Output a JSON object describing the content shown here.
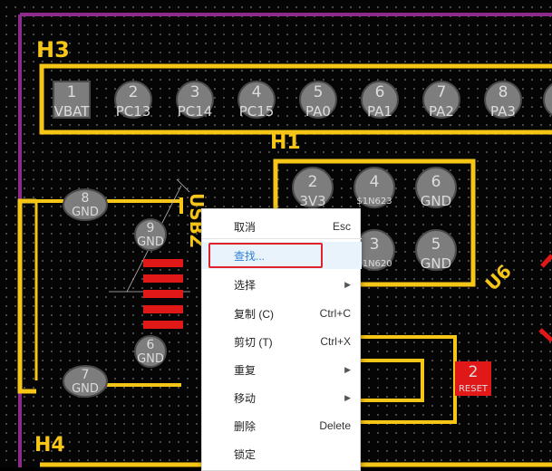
{
  "board": {
    "headers": {
      "h3": "H3",
      "h1": "H1",
      "h4": "H4",
      "usb": "USBZ",
      "u6": "U6"
    },
    "h3_pads": [
      {
        "num": "1",
        "name": "VBAT"
      },
      {
        "num": "2",
        "name": "PC13"
      },
      {
        "num": "3",
        "name": "PC14"
      },
      {
        "num": "4",
        "name": "PC15"
      },
      {
        "num": "5",
        "name": "PA0"
      },
      {
        "num": "6",
        "name": "PA1"
      },
      {
        "num": "7",
        "name": "PA2"
      },
      {
        "num": "8",
        "name": "PA3"
      }
    ],
    "h1_pads": [
      {
        "num": "2",
        "name": "3V3"
      },
      {
        "num": "4",
        "name": "$1N623"
      },
      {
        "num": "6",
        "name": "GND"
      },
      {
        "num": "3",
        "name": "$1N620"
      },
      {
        "num": "5",
        "name": "GND"
      }
    ],
    "usb_pads": [
      {
        "num": "8",
        "name": "GND"
      },
      {
        "num": "9",
        "name": "GND"
      },
      {
        "num": "6",
        "name": "GND"
      },
      {
        "num": "7",
        "name": "GND"
      }
    ],
    "reset_pad": {
      "num": "2",
      "name": "RESET"
    },
    "colors": {
      "silkscreen": "#f5c518",
      "board_outline": "#8e2a8a",
      "pad": "#7d7d7d",
      "pad_red": "#e01818"
    }
  },
  "context_menu": {
    "items": [
      {
        "label": "取消",
        "shortcut": "Esc",
        "submenu": false
      },
      {
        "label": "查找...",
        "shortcut": "",
        "submenu": false
      },
      {
        "label": "选择",
        "shortcut": "",
        "submenu": true
      },
      {
        "label": "复制 (C)",
        "shortcut": "Ctrl+C",
        "submenu": false
      },
      {
        "label": "剪切 (T)",
        "shortcut": "Ctrl+X",
        "submenu": false
      },
      {
        "label": "重复",
        "shortcut": "",
        "submenu": true
      },
      {
        "label": "移动",
        "shortcut": "",
        "submenu": true
      },
      {
        "label": "删除",
        "shortcut": "Delete",
        "submenu": false
      },
      {
        "label": "锁定",
        "shortcut": "",
        "submenu": false
      }
    ],
    "highlighted_item": "查找..."
  }
}
